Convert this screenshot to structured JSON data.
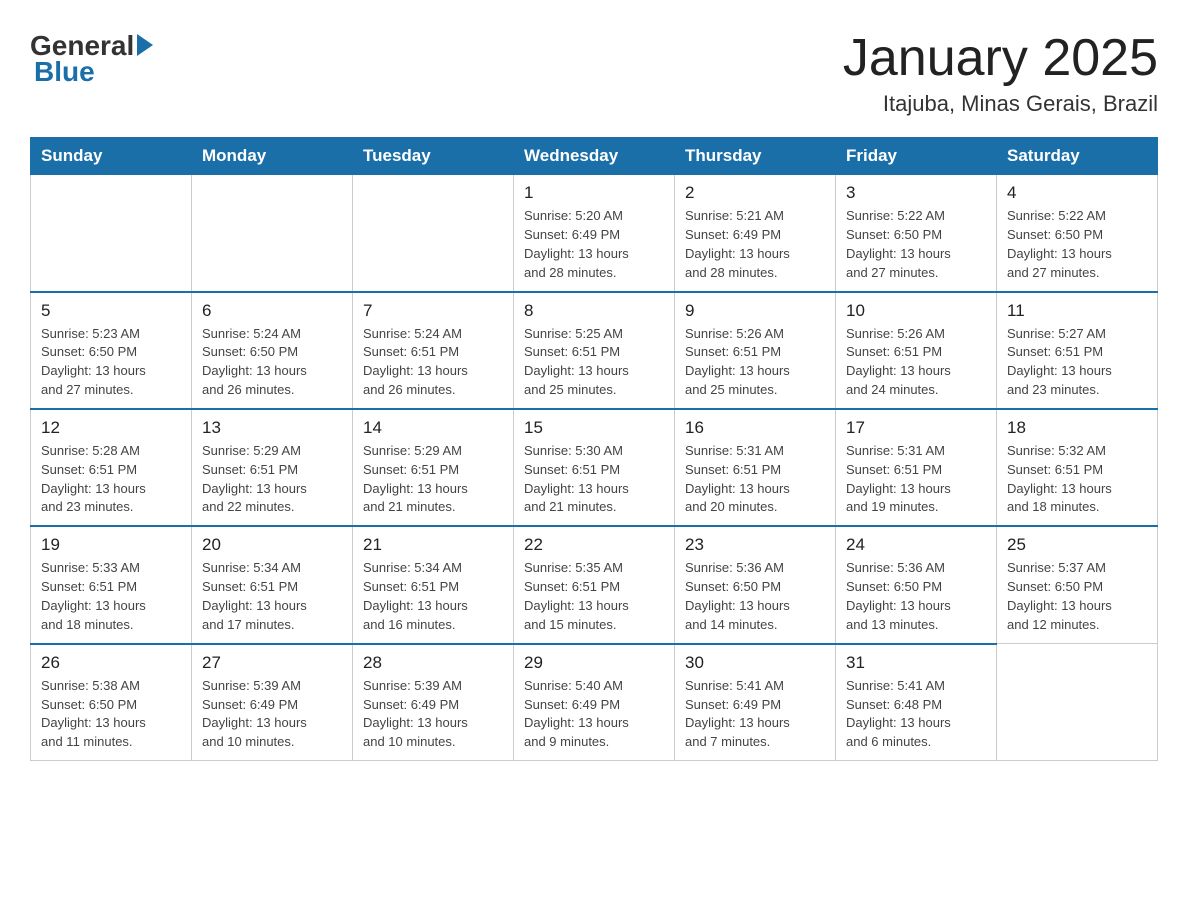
{
  "header": {
    "logo_general": "General",
    "logo_blue": "Blue",
    "title": "January 2025",
    "subtitle": "Itajuba, Minas Gerais, Brazil"
  },
  "columns": [
    "Sunday",
    "Monday",
    "Tuesday",
    "Wednesday",
    "Thursday",
    "Friday",
    "Saturday"
  ],
  "weeks": [
    [
      {
        "day": "",
        "info": ""
      },
      {
        "day": "",
        "info": ""
      },
      {
        "day": "",
        "info": ""
      },
      {
        "day": "1",
        "info": "Sunrise: 5:20 AM\nSunset: 6:49 PM\nDaylight: 13 hours\nand 28 minutes."
      },
      {
        "day": "2",
        "info": "Sunrise: 5:21 AM\nSunset: 6:49 PM\nDaylight: 13 hours\nand 28 minutes."
      },
      {
        "day": "3",
        "info": "Sunrise: 5:22 AM\nSunset: 6:50 PM\nDaylight: 13 hours\nand 27 minutes."
      },
      {
        "day": "4",
        "info": "Sunrise: 5:22 AM\nSunset: 6:50 PM\nDaylight: 13 hours\nand 27 minutes."
      }
    ],
    [
      {
        "day": "5",
        "info": "Sunrise: 5:23 AM\nSunset: 6:50 PM\nDaylight: 13 hours\nand 27 minutes."
      },
      {
        "day": "6",
        "info": "Sunrise: 5:24 AM\nSunset: 6:50 PM\nDaylight: 13 hours\nand 26 minutes."
      },
      {
        "day": "7",
        "info": "Sunrise: 5:24 AM\nSunset: 6:51 PM\nDaylight: 13 hours\nand 26 minutes."
      },
      {
        "day": "8",
        "info": "Sunrise: 5:25 AM\nSunset: 6:51 PM\nDaylight: 13 hours\nand 25 minutes."
      },
      {
        "day": "9",
        "info": "Sunrise: 5:26 AM\nSunset: 6:51 PM\nDaylight: 13 hours\nand 25 minutes."
      },
      {
        "day": "10",
        "info": "Sunrise: 5:26 AM\nSunset: 6:51 PM\nDaylight: 13 hours\nand 24 minutes."
      },
      {
        "day": "11",
        "info": "Sunrise: 5:27 AM\nSunset: 6:51 PM\nDaylight: 13 hours\nand 23 minutes."
      }
    ],
    [
      {
        "day": "12",
        "info": "Sunrise: 5:28 AM\nSunset: 6:51 PM\nDaylight: 13 hours\nand 23 minutes."
      },
      {
        "day": "13",
        "info": "Sunrise: 5:29 AM\nSunset: 6:51 PM\nDaylight: 13 hours\nand 22 minutes."
      },
      {
        "day": "14",
        "info": "Sunrise: 5:29 AM\nSunset: 6:51 PM\nDaylight: 13 hours\nand 21 minutes."
      },
      {
        "day": "15",
        "info": "Sunrise: 5:30 AM\nSunset: 6:51 PM\nDaylight: 13 hours\nand 21 minutes."
      },
      {
        "day": "16",
        "info": "Sunrise: 5:31 AM\nSunset: 6:51 PM\nDaylight: 13 hours\nand 20 minutes."
      },
      {
        "day": "17",
        "info": "Sunrise: 5:31 AM\nSunset: 6:51 PM\nDaylight: 13 hours\nand 19 minutes."
      },
      {
        "day": "18",
        "info": "Sunrise: 5:32 AM\nSunset: 6:51 PM\nDaylight: 13 hours\nand 18 minutes."
      }
    ],
    [
      {
        "day": "19",
        "info": "Sunrise: 5:33 AM\nSunset: 6:51 PM\nDaylight: 13 hours\nand 18 minutes."
      },
      {
        "day": "20",
        "info": "Sunrise: 5:34 AM\nSunset: 6:51 PM\nDaylight: 13 hours\nand 17 minutes."
      },
      {
        "day": "21",
        "info": "Sunrise: 5:34 AM\nSunset: 6:51 PM\nDaylight: 13 hours\nand 16 minutes."
      },
      {
        "day": "22",
        "info": "Sunrise: 5:35 AM\nSunset: 6:51 PM\nDaylight: 13 hours\nand 15 minutes."
      },
      {
        "day": "23",
        "info": "Sunrise: 5:36 AM\nSunset: 6:50 PM\nDaylight: 13 hours\nand 14 minutes."
      },
      {
        "day": "24",
        "info": "Sunrise: 5:36 AM\nSunset: 6:50 PM\nDaylight: 13 hours\nand 13 minutes."
      },
      {
        "day": "25",
        "info": "Sunrise: 5:37 AM\nSunset: 6:50 PM\nDaylight: 13 hours\nand 12 minutes."
      }
    ],
    [
      {
        "day": "26",
        "info": "Sunrise: 5:38 AM\nSunset: 6:50 PM\nDaylight: 13 hours\nand 11 minutes."
      },
      {
        "day": "27",
        "info": "Sunrise: 5:39 AM\nSunset: 6:49 PM\nDaylight: 13 hours\nand 10 minutes."
      },
      {
        "day": "28",
        "info": "Sunrise: 5:39 AM\nSunset: 6:49 PM\nDaylight: 13 hours\nand 10 minutes."
      },
      {
        "day": "29",
        "info": "Sunrise: 5:40 AM\nSunset: 6:49 PM\nDaylight: 13 hours\nand 9 minutes."
      },
      {
        "day": "30",
        "info": "Sunrise: 5:41 AM\nSunset: 6:49 PM\nDaylight: 13 hours\nand 7 minutes."
      },
      {
        "day": "31",
        "info": "Sunrise: 5:41 AM\nSunset: 6:48 PM\nDaylight: 13 hours\nand 6 minutes."
      },
      {
        "day": "",
        "info": ""
      }
    ]
  ]
}
